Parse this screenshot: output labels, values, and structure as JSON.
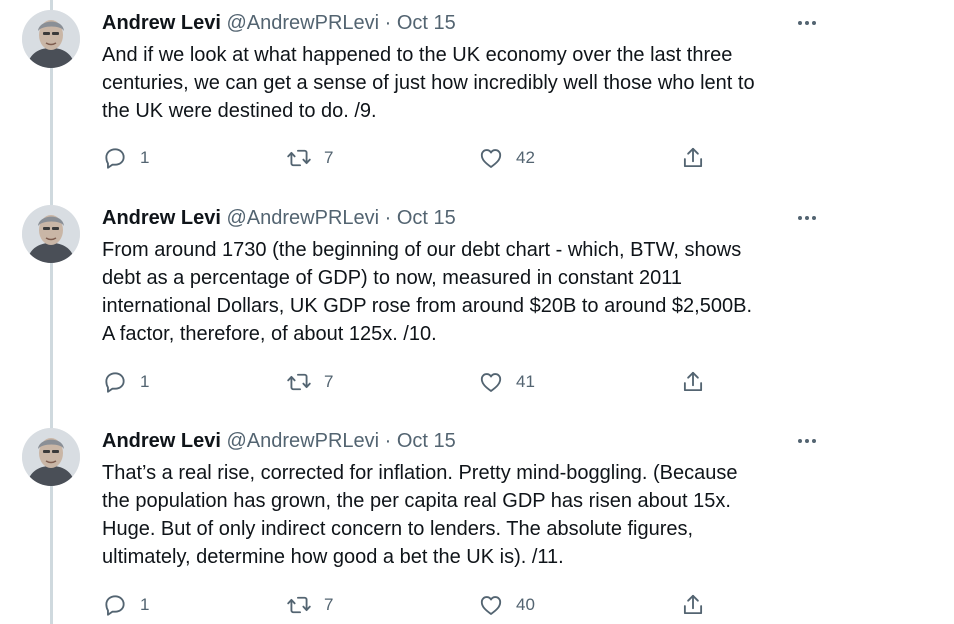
{
  "tweets": [
    {
      "name": "Andrew Levi",
      "handle": "@AndrewPRLevi",
      "separator": "·",
      "date": "Oct 15",
      "lines": [
        "And if we look at what happened to the UK economy over the last three",
        "centuries, we can get a sense of just how incredibly well those who lent to",
        "the UK were destined to do. /9."
      ],
      "replies": "1",
      "retweets": "7",
      "likes": "42"
    },
    {
      "name": "Andrew Levi",
      "handle": "@AndrewPRLevi",
      "separator": "·",
      "date": "Oct 15",
      "lines": [
        "From around 1730 (the beginning of our debt chart - which, BTW, shows",
        "debt as a percentage of GDP) to now, measured in constant 2011",
        "international Dollars, UK GDP rose from around $20B to around $2,500B.",
        "A factor, therefore, of about 125x. /10."
      ],
      "replies": "1",
      "retweets": "7",
      "likes": "41"
    },
    {
      "name": "Andrew Levi",
      "handle": "@AndrewPRLevi",
      "separator": "·",
      "date": "Oct 15",
      "lines": [
        "That’s a real rise, corrected for inflation. Pretty mind-boggling. (Because",
        "the population has grown, the per capita real GDP has risen about 15x.",
        "Huge. But of only indirect concern to lenders. The absolute figures,",
        "ultimately, determine how good a bet the UK is). /11."
      ],
      "replies": "1",
      "retweets": "7",
      "likes": "40"
    }
  ],
  "icons": {
    "reply": "reply-icon",
    "retweet": "retweet-icon",
    "like": "heart-icon",
    "share": "share-icon",
    "more": "more-options-icon"
  },
  "colors": {
    "text": "#0f1419",
    "muted": "#536471",
    "thread_line": "#cfd9de"
  }
}
